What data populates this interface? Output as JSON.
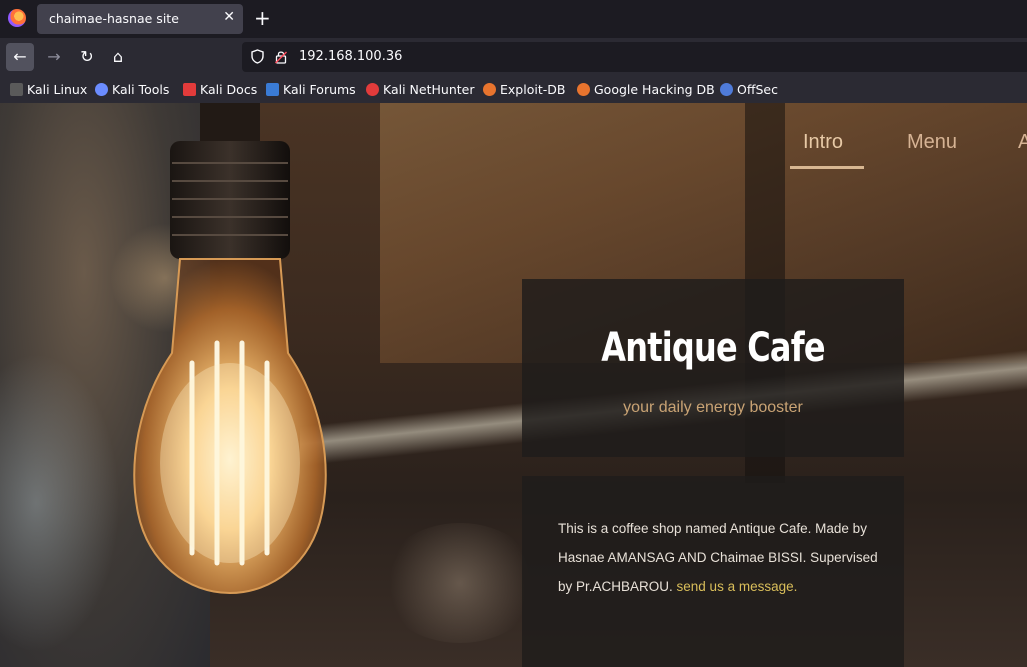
{
  "browser": {
    "tab_title": "chaimae-hasnae site",
    "close_glyph": "✕",
    "new_tab_glyph": "+",
    "url": "192.168.100.36",
    "nav_glyphs": {
      "back": "←",
      "forward": "→",
      "reload": "↻",
      "home": "⌂"
    },
    "bookmarks": [
      {
        "label": "Kali Linux",
        "icon": "kali-dragon-icon",
        "color": "#c7c7c7"
      },
      {
        "label": "Kali Tools",
        "icon": "kali-tools-icon",
        "color": "#6b8cff"
      },
      {
        "label": "Kali Docs",
        "icon": "kali-docs-icon",
        "color": "#e23b3b"
      },
      {
        "label": "Kali Forums",
        "icon": "kali-forums-icon",
        "color": "#3a7bd5"
      },
      {
        "label": "Kali NetHunter",
        "icon": "kali-nethunter-icon",
        "color": "#e23b3b"
      },
      {
        "label": "Exploit-DB",
        "icon": "exploit-db-icon",
        "color": "#e8742e"
      },
      {
        "label": "Google Hacking DB",
        "icon": "ghdb-icon",
        "color": "#e8742e"
      },
      {
        "label": "OffSec",
        "icon": "offsec-icon",
        "color": "#4f7bd9"
      }
    ]
  },
  "site": {
    "nav": {
      "intro": "Intro",
      "menu": "Menu",
      "more": "A"
    },
    "hero": {
      "title": "Antique Cafe",
      "subtitle": "your daily energy booster"
    },
    "description": {
      "text": "This is a coffee shop named Antique Cafe. Made by Hasnae AMANSAG AND Chaimae BISSI. Supervised by Pr.ACHBAROU. send us a message.",
      "link": "send us a message."
    },
    "colors": {
      "accent": "#c9a374",
      "link": "#d9be5a",
      "underline": "#d8b792"
    }
  }
}
